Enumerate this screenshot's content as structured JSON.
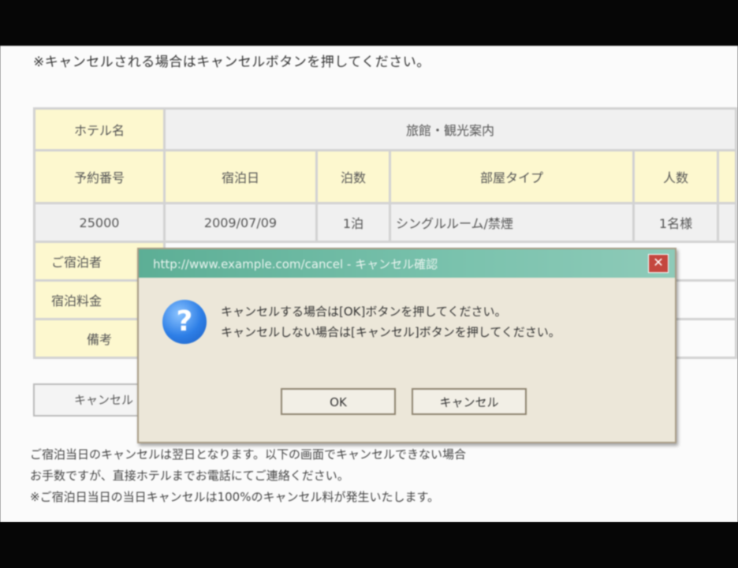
{
  "page": {
    "notice_top": "※キャンセルされる場合はキャンセルボタンを押してください。",
    "table": {
      "hotel_label": "ホテル名",
      "hotel_value": "旅館・観光案内",
      "headers": [
        "予約番号",
        "宿泊日",
        "泊数",
        "部屋タイプ",
        "人数"
      ],
      "row": [
        "25000",
        "2009/07/09",
        "1泊",
        "シングルルーム/禁煙",
        "1名様"
      ],
      "extra_rows": [
        "ご宿泊者",
        "宿泊料金",
        "備考"
      ]
    },
    "page_button_label": "キャンセル",
    "footer_notes": [
      "ご宿泊当日のキャンセルは翌日となります。以下の画面でキャンセルできない場合",
      "お手数ですが、直接ホテルまでお電話にてご連絡ください。",
      "※ご宿泊日当日の当日キャンセルは100%のキャンセル料が発生いたします。"
    ]
  },
  "dialog": {
    "title": "http://www.example.com/cancel - キャンセル確認",
    "close_symbol": "✕",
    "icon_glyph": "?",
    "icon": "question-icon",
    "message_lines": [
      "キャンセルする場合は[OK]ボタンを押してください。",
      "キャンセルしない場合は[キャンセル]ボタンを押してください。"
    ],
    "ok_label": "OK",
    "cancel_label": "キャンセル"
  },
  "colors": {
    "titlebar": "#5cae95",
    "header_cell": "#fdf8cf",
    "dialog_bg": "#ece7d9"
  }
}
